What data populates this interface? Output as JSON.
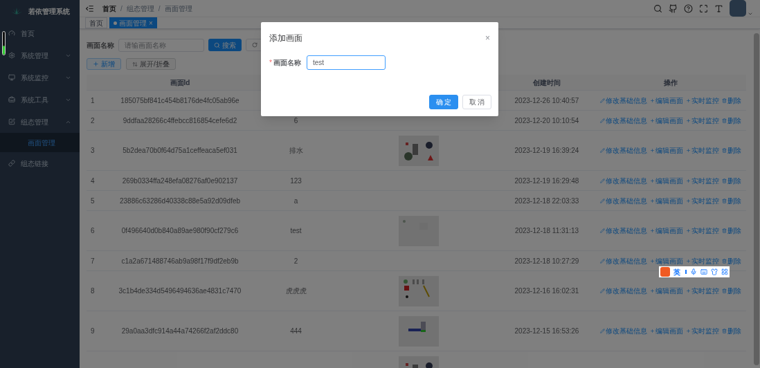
{
  "sidebar": {
    "logo_text": "若依管理系统",
    "items": [
      {
        "label": "首页",
        "kind": "link"
      },
      {
        "label": "系统管理",
        "kind": "group",
        "expanded": false
      },
      {
        "label": "系统监控",
        "kind": "group",
        "expanded": false
      },
      {
        "label": "系统工具",
        "kind": "group",
        "expanded": false
      },
      {
        "label": "组态管理",
        "kind": "group",
        "expanded": true,
        "children": [
          {
            "label": "画面管理",
            "selected": true
          }
        ]
      },
      {
        "label": "组态链接",
        "kind": "link"
      }
    ]
  },
  "side_meter": {
    "level": 0.4
  },
  "breadcrumb": [
    {
      "label": "首页"
    },
    {
      "separator": "/",
      "label": "组态管理"
    },
    {
      "separator": "/",
      "label": "画面管理"
    }
  ],
  "tags": [
    {
      "label": "首页",
      "selected": false
    },
    {
      "label": "画面管理",
      "selected": true,
      "close": "×"
    }
  ],
  "search_form": {
    "label": "画面名称",
    "placeholder": "请输画面名称",
    "search_button": "搜索"
  },
  "toolbar": {
    "add_button": "新增",
    "toggle_button": "展开/折叠"
  },
  "table": {
    "columns": [
      "画面Id",
      "创建时间",
      "操作"
    ],
    "rows": [
      {
        "index": "1",
        "id": "185075bf841c454b8176de4fc05ab96e",
        "time": "2023-12-26 10:40:57",
        "thumbnail": false,
        "actions": [
          "修改基础信息",
          "编辑画面",
          "实时监控",
          "删除"
        ]
      },
      {
        "index": "2",
        "id": "9ddfaa28266c4ffebcc816854cefe6d2",
        "name": "6",
        "time": "2023-12-20 10:10:54",
        "thumbnail": false,
        "actions": [
          "修改基础信息",
          "编辑画面",
          "实时监控",
          "删除"
        ]
      },
      {
        "index": "3",
        "id": "5b2dea70b0f64d75a1ceffeaca5ef031",
        "name": "排水",
        "time": "2023-12-19 16:39:24",
        "thumbnail": true,
        "actions": [
          "修改基础信息",
          "编辑画面",
          "实时监控",
          "删除"
        ]
      },
      {
        "index": "4",
        "id": "269b0334ffa248efa08276af0e902137",
        "name": "123",
        "time": "2023-12-19 16:29:48",
        "thumbnail": false,
        "actions": [
          "修改基础信息",
          "编辑画面",
          "实时监控",
          "删除"
        ]
      },
      {
        "index": "5",
        "id": "23886c63286d40338c88e5a92d09dfeb",
        "name": "a",
        "time": "2023-12-18 22:03:33",
        "thumbnail": false,
        "actions": [
          "修改基础信息",
          "编辑画面",
          "实时监控",
          "删除"
        ]
      },
      {
        "index": "6",
        "id": "0f496640d0b840a89ae980f90cf279c6",
        "name": "test",
        "time": "2023-12-18 11:31:13",
        "thumbnail": true,
        "actions": [
          "修改基础信息",
          "编辑画面",
          "实时监控",
          "删除"
        ]
      },
      {
        "index": "7",
        "id": "c1a2a671488746ab9a98f17f9df2eb9b",
        "name": "2",
        "time": "2023-12-18 10:27:29",
        "thumbnail": false,
        "actions": [
          "修改基础信息",
          "编辑画面",
          "实时监控",
          "删除"
        ]
      },
      {
        "index": "8",
        "id": "3c1b4de334d5496494636ae4831c7470",
        "name": "虎虎虎",
        "time": "2023-12-16 16:02:31",
        "thumbnail": true,
        "actions": [
          "修改基础信息",
          "编辑画面",
          "实时监控",
          "删除"
        ]
      },
      {
        "index": "9",
        "id": "29a0aa3dfc914a44a74266f2af2ddc80",
        "name": "444",
        "time": "2023-12-15 16:53:26",
        "thumbnail": true,
        "actions": [
          "修改基础信息",
          "编辑画面",
          "实时监控",
          "删除"
        ]
      },
      {
        "thumbnail": true
      }
    ]
  },
  "dialog": {
    "title": "添加画面",
    "close": "×",
    "field": {
      "label": "画面名称",
      "required_mark": "*",
      "value": "test"
    },
    "buttons": [
      {
        "label": "确 定",
        "kind": "primary"
      },
      {
        "label": "取 消",
        "kind": "default"
      }
    ]
  },
  "ime_toolbar": {
    "mode": "英"
  }
}
